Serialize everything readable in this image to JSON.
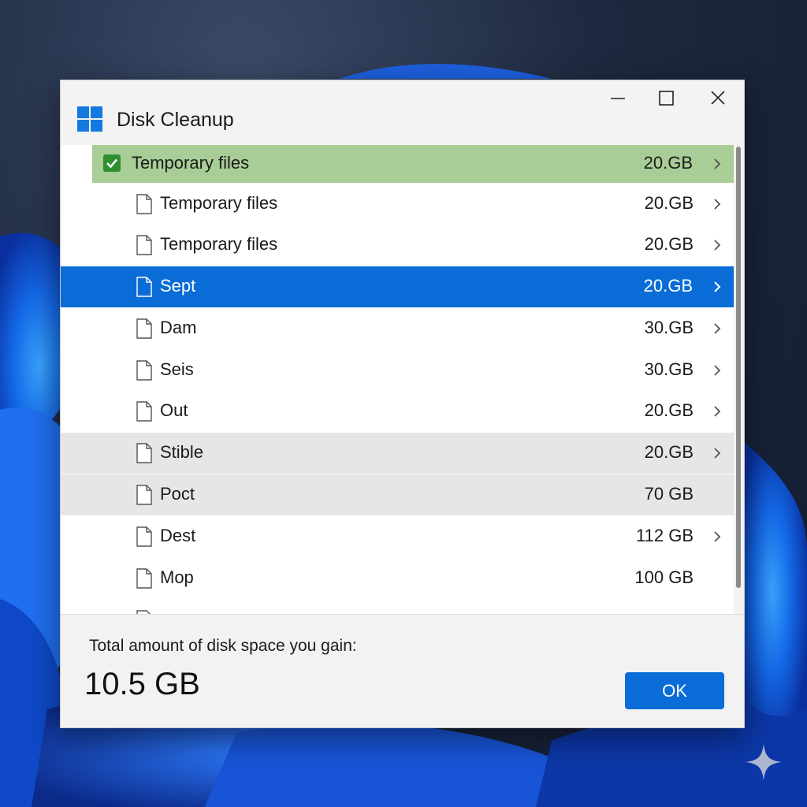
{
  "window": {
    "title": "Disk Cleanup",
    "app_icon": "windows-logo-icon",
    "accent": "#0a6cd7"
  },
  "items": [
    {
      "name": "Temporary files",
      "size": "20.GB",
      "checked": true,
      "chevron": true,
      "state": "checked-header"
    },
    {
      "name": "Temporary files",
      "size": "20.GB",
      "chevron": true,
      "state": "normal"
    },
    {
      "name": "Temporary files",
      "size": "20.GB",
      "chevron": true,
      "state": "normal"
    },
    {
      "name": "Sept",
      "size": "20.GB",
      "chevron": true,
      "state": "selected"
    },
    {
      "name": "Dam",
      "size": "30.GB",
      "chevron": true,
      "state": "normal"
    },
    {
      "name": "Seis",
      "size": "30.GB",
      "chevron": true,
      "state": "normal"
    },
    {
      "name": "Out",
      "size": "20.GB",
      "chevron": true,
      "state": "normal"
    },
    {
      "name": "Stible",
      "size": "20.GB",
      "chevron": true,
      "state": "hover"
    },
    {
      "name": "Poct",
      "size": "70 GB",
      "chevron": false,
      "state": "hover"
    },
    {
      "name": "Dest",
      "size": "112 GB",
      "chevron": true,
      "state": "normal"
    },
    {
      "name": "Mop",
      "size": "100 GB",
      "chevron": false,
      "state": "normal"
    }
  ],
  "footer": {
    "label": "Total amount of disk space you gain:",
    "total": "10.5 GB",
    "ok_label": "OK"
  }
}
